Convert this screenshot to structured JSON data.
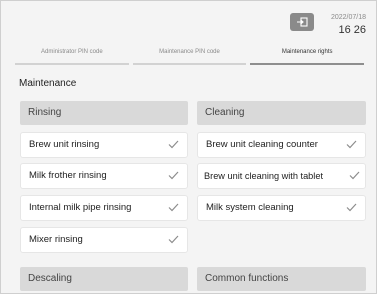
{
  "header": {
    "date": "2022/07/18",
    "time": "16 26"
  },
  "tabs": [
    {
      "label": "Administrator PIN code"
    },
    {
      "label": "Maintenance PIN code"
    },
    {
      "label": "Maintenance rights"
    }
  ],
  "section": {
    "title": "Maintenance"
  },
  "groups": {
    "rinsing": {
      "title": "Rinsing",
      "items": [
        {
          "label": "Brew unit rinsing"
        },
        {
          "label": "Milk frother rinsing"
        },
        {
          "label": "Internal milk pipe rinsing"
        },
        {
          "label": "Mixer rinsing"
        }
      ]
    },
    "cleaning": {
      "title": "Cleaning",
      "items": [
        {
          "label": "Brew unit cleaning counter"
        },
        {
          "label": "Brew unit cleaning with tablet"
        },
        {
          "label": "Milk system cleaning"
        }
      ]
    },
    "descaling": {
      "title": "Descaling"
    },
    "common": {
      "title": "Common functions"
    }
  },
  "icons": {
    "exit": "exit-icon",
    "check": "check-icon"
  },
  "colors": {
    "accent": "#8a8a8a",
    "group_header": "#d9d9d9",
    "check": "#8c8c8c"
  }
}
